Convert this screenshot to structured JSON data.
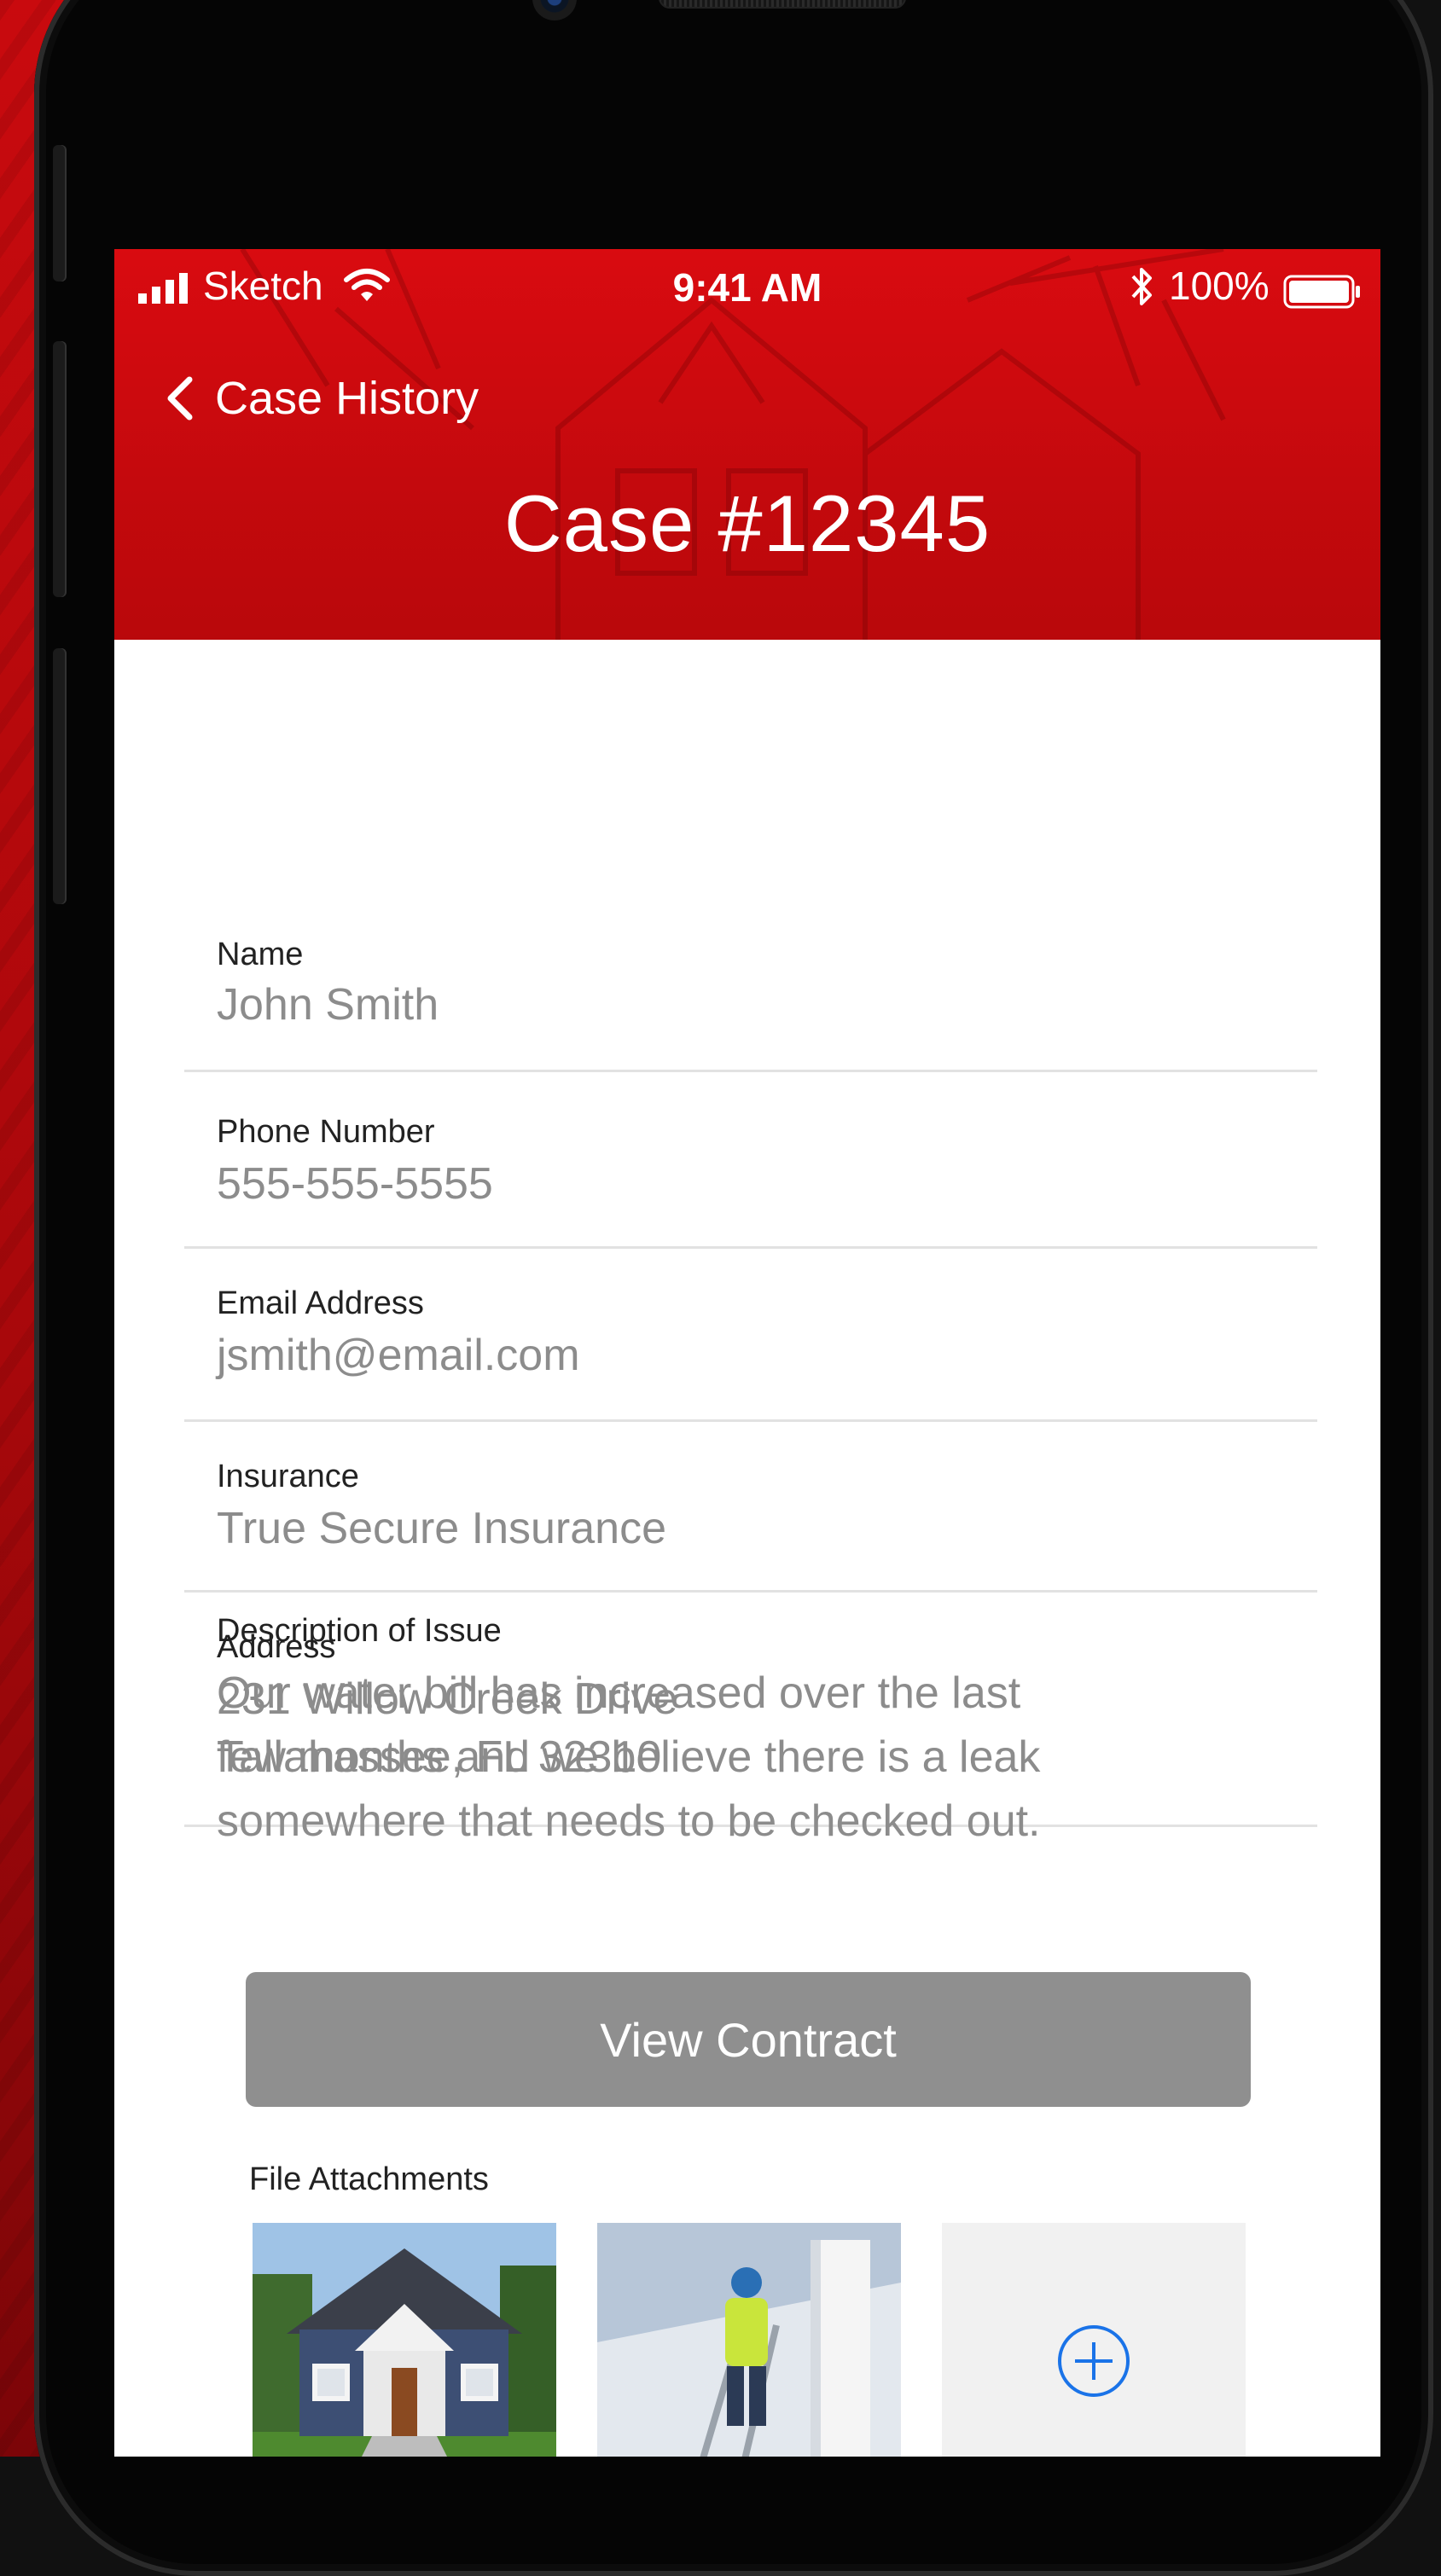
{
  "status_bar": {
    "carrier": "Sketch",
    "time": "9:41 AM",
    "battery_percent": "100%",
    "icons": [
      "signal-icon",
      "wifi-icon",
      "bluetooth-icon",
      "battery-icon"
    ]
  },
  "nav": {
    "back_label": "Case History",
    "title": "Case #12345"
  },
  "fields": {
    "name": {
      "label": "Name",
      "value": "John Smith"
    },
    "phone": {
      "label": "Phone Number",
      "value": "555-555-5555"
    },
    "email": {
      "label": "Email Address",
      "value": "jsmith@email.com"
    },
    "insurance": {
      "label": "Insurance",
      "value": "True Secure Insurance"
    },
    "address": {
      "label": "Address",
      "value": "231 Willow Creek Drive\nTallahassee, FL 32310"
    }
  },
  "description": {
    "label": "Description of Issue",
    "value": "Our water bill has increased over the last few months and we believe there is a leak somewhere that needs to be checked out."
  },
  "actions": {
    "view_contract_label": "View Contract"
  },
  "attachments": {
    "label": "File Attachments",
    "items": [
      "house-photo",
      "worker-on-ladder-photo"
    ],
    "add_icon": "plus-circle-icon"
  },
  "colors": {
    "header_red": "#d90b10",
    "button_gray": "#8f8f8f",
    "text_gray": "#8c8c8c",
    "add_blue": "#1a73e8"
  }
}
